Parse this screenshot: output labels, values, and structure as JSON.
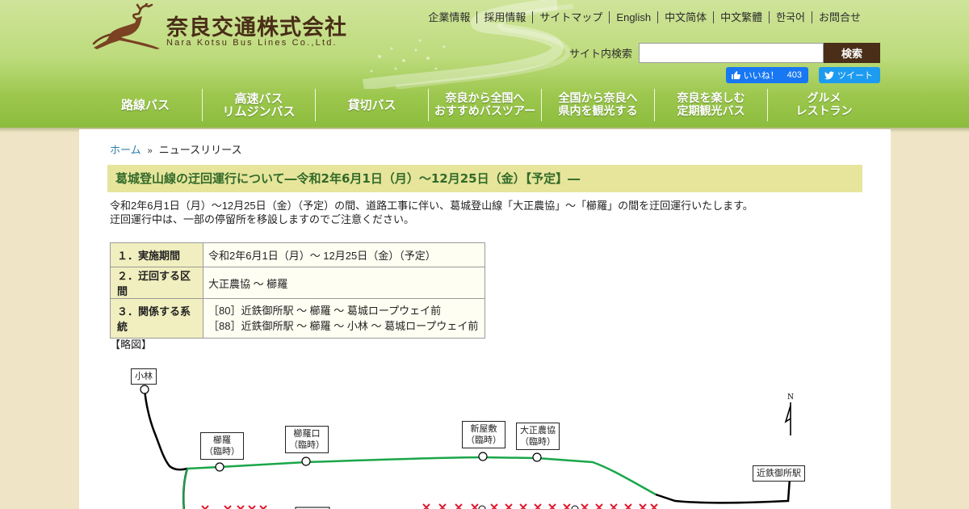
{
  "brand": {
    "name_ja": "奈良交通株式会社",
    "name_en": "Nara Kotsu Bus Lines Co.,Ltd.",
    "color_dark": "#4a2e18",
    "color_green": "#8cbc3d"
  },
  "util_links": [
    "企業情報",
    "採用情報",
    "サイトマップ",
    "English",
    "中文简体",
    "中文繁體",
    "한국어",
    "お問合せ"
  ],
  "search": {
    "label": "サイト内検索",
    "placeholder": "",
    "button": "検索"
  },
  "social": {
    "like_label": "いいね！",
    "like_count": "403",
    "tweet_label": "ツイート"
  },
  "gnav": [
    {
      "label": "路線バス"
    },
    {
      "label": "高速バス\nリムジンバス"
    },
    {
      "label": "貸切バス"
    },
    {
      "label": "奈良から全国へ\nおすすめバスツアー"
    },
    {
      "label": "全国から奈良へ\n県内を観光する"
    },
    {
      "label": "奈良を楽しむ\n定期観光バス"
    },
    {
      "label": "グルメ\nレストラン"
    }
  ],
  "breadcrumb": {
    "home": "ホーム",
    "current": "ニュースリリース"
  },
  "article": {
    "title": "葛城登山線の迂回運行について―令和2年6月1日（月）～12月25日（金）【予定】―",
    "intro_1": "令和2年6月1日（月）～12月25日（金）（予定）の間、道路工事に伴い、葛城登山線「大正農協」～「櫛羅」の間を迂回運行いたします。",
    "intro_2": "迂回運行中は、一部の停留所を移設しますのでご注意ください。",
    "table": [
      {
        "head": "１．実施期間",
        "value": "令和2年6月1日（月）～ 12月25日（金）（予定）"
      },
      {
        "head": "２．迂回する区間",
        "value": "大正農協 ～ 櫛羅"
      },
      {
        "head": "３．関係する系統",
        "lines": [
          "［80］近鉄御所駅 ～ 櫛羅 ～ 葛城ロープウェイ前",
          "［88］近鉄御所駅 ～ 櫛羅 ～ 小林 ～ 葛城ロープウェイ前"
        ]
      }
    ],
    "sketch_label": "【略図】"
  },
  "map": {
    "north": "N",
    "stops": {
      "kobayashi": "小林",
      "kujira": "櫛羅\n（臨時）",
      "kujira_guchi": "櫛羅口\n（臨時）",
      "shinyashiki": "新屋敷\n（臨時）",
      "taisho_nokyo": "大正農協\n（臨時）",
      "gose_station": "近鉄御所駅"
    },
    "detour_color": "#1aa64a",
    "closed_color": "#e0182d"
  }
}
